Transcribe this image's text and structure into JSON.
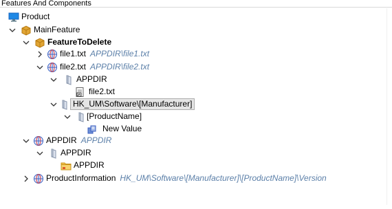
{
  "panel": {
    "title": "Features And Components"
  },
  "tree": {
    "product": "Product",
    "main_feature": "MainFeature",
    "feature_to_delete": "FeatureToDelete",
    "file1": {
      "name": "file1.txt",
      "path": "APPDIR\\file1.txt"
    },
    "file2": {
      "name": "file2.txt",
      "path": "APPDIR\\file2.txt"
    },
    "file2_appdir": "APPDIR",
    "file2_leaf": "file2.txt",
    "registry_key": "HK_UM\\Software\\[Manufacturer]",
    "product_name_key": "[ProductName]",
    "new_value": "New Value",
    "appdir_component": {
      "name": "APPDIR",
      "path": "APPDIR"
    },
    "appdir_folder": "APPDIR",
    "appdir_subfolder": "APPDIR",
    "product_information": {
      "name": "ProductInformation",
      "path": "HK_UM\\Software\\[Manufacturer]\\[ProductName]\\Version"
    }
  },
  "colors": {
    "path_text": "#5b7fa8",
    "folder_yellow": "#f2c14b",
    "box_gold": "#e1a534",
    "selection": "#e5e5e5"
  },
  "icons": [
    "monitor-icon",
    "feature-box-icon",
    "globe-component-icon",
    "pale-folder-icon",
    "file-shortcut-icon",
    "registry-value-icon",
    "yellow-folder-icon"
  ]
}
